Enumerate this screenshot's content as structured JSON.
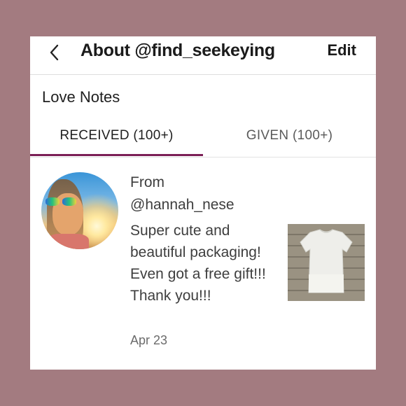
{
  "header": {
    "title": "About @find_seekeying",
    "edit_label": "Edit",
    "back_icon": "chevron-left-icon"
  },
  "section": {
    "title": "Love Notes"
  },
  "tabs": [
    {
      "label": "RECEIVED (100+)",
      "active": true
    },
    {
      "label": "GIVEN (100+)",
      "active": false
    }
  ],
  "notes": [
    {
      "from_label": "From",
      "from_user": "@hannah_nese",
      "message": "Super cute and beautiful packaging! Even got a free gift!!! Thank you!!!",
      "date": "Apr 23"
    }
  ],
  "colors": {
    "background": "#a37b80",
    "tab_accent": "#7b1f56"
  }
}
